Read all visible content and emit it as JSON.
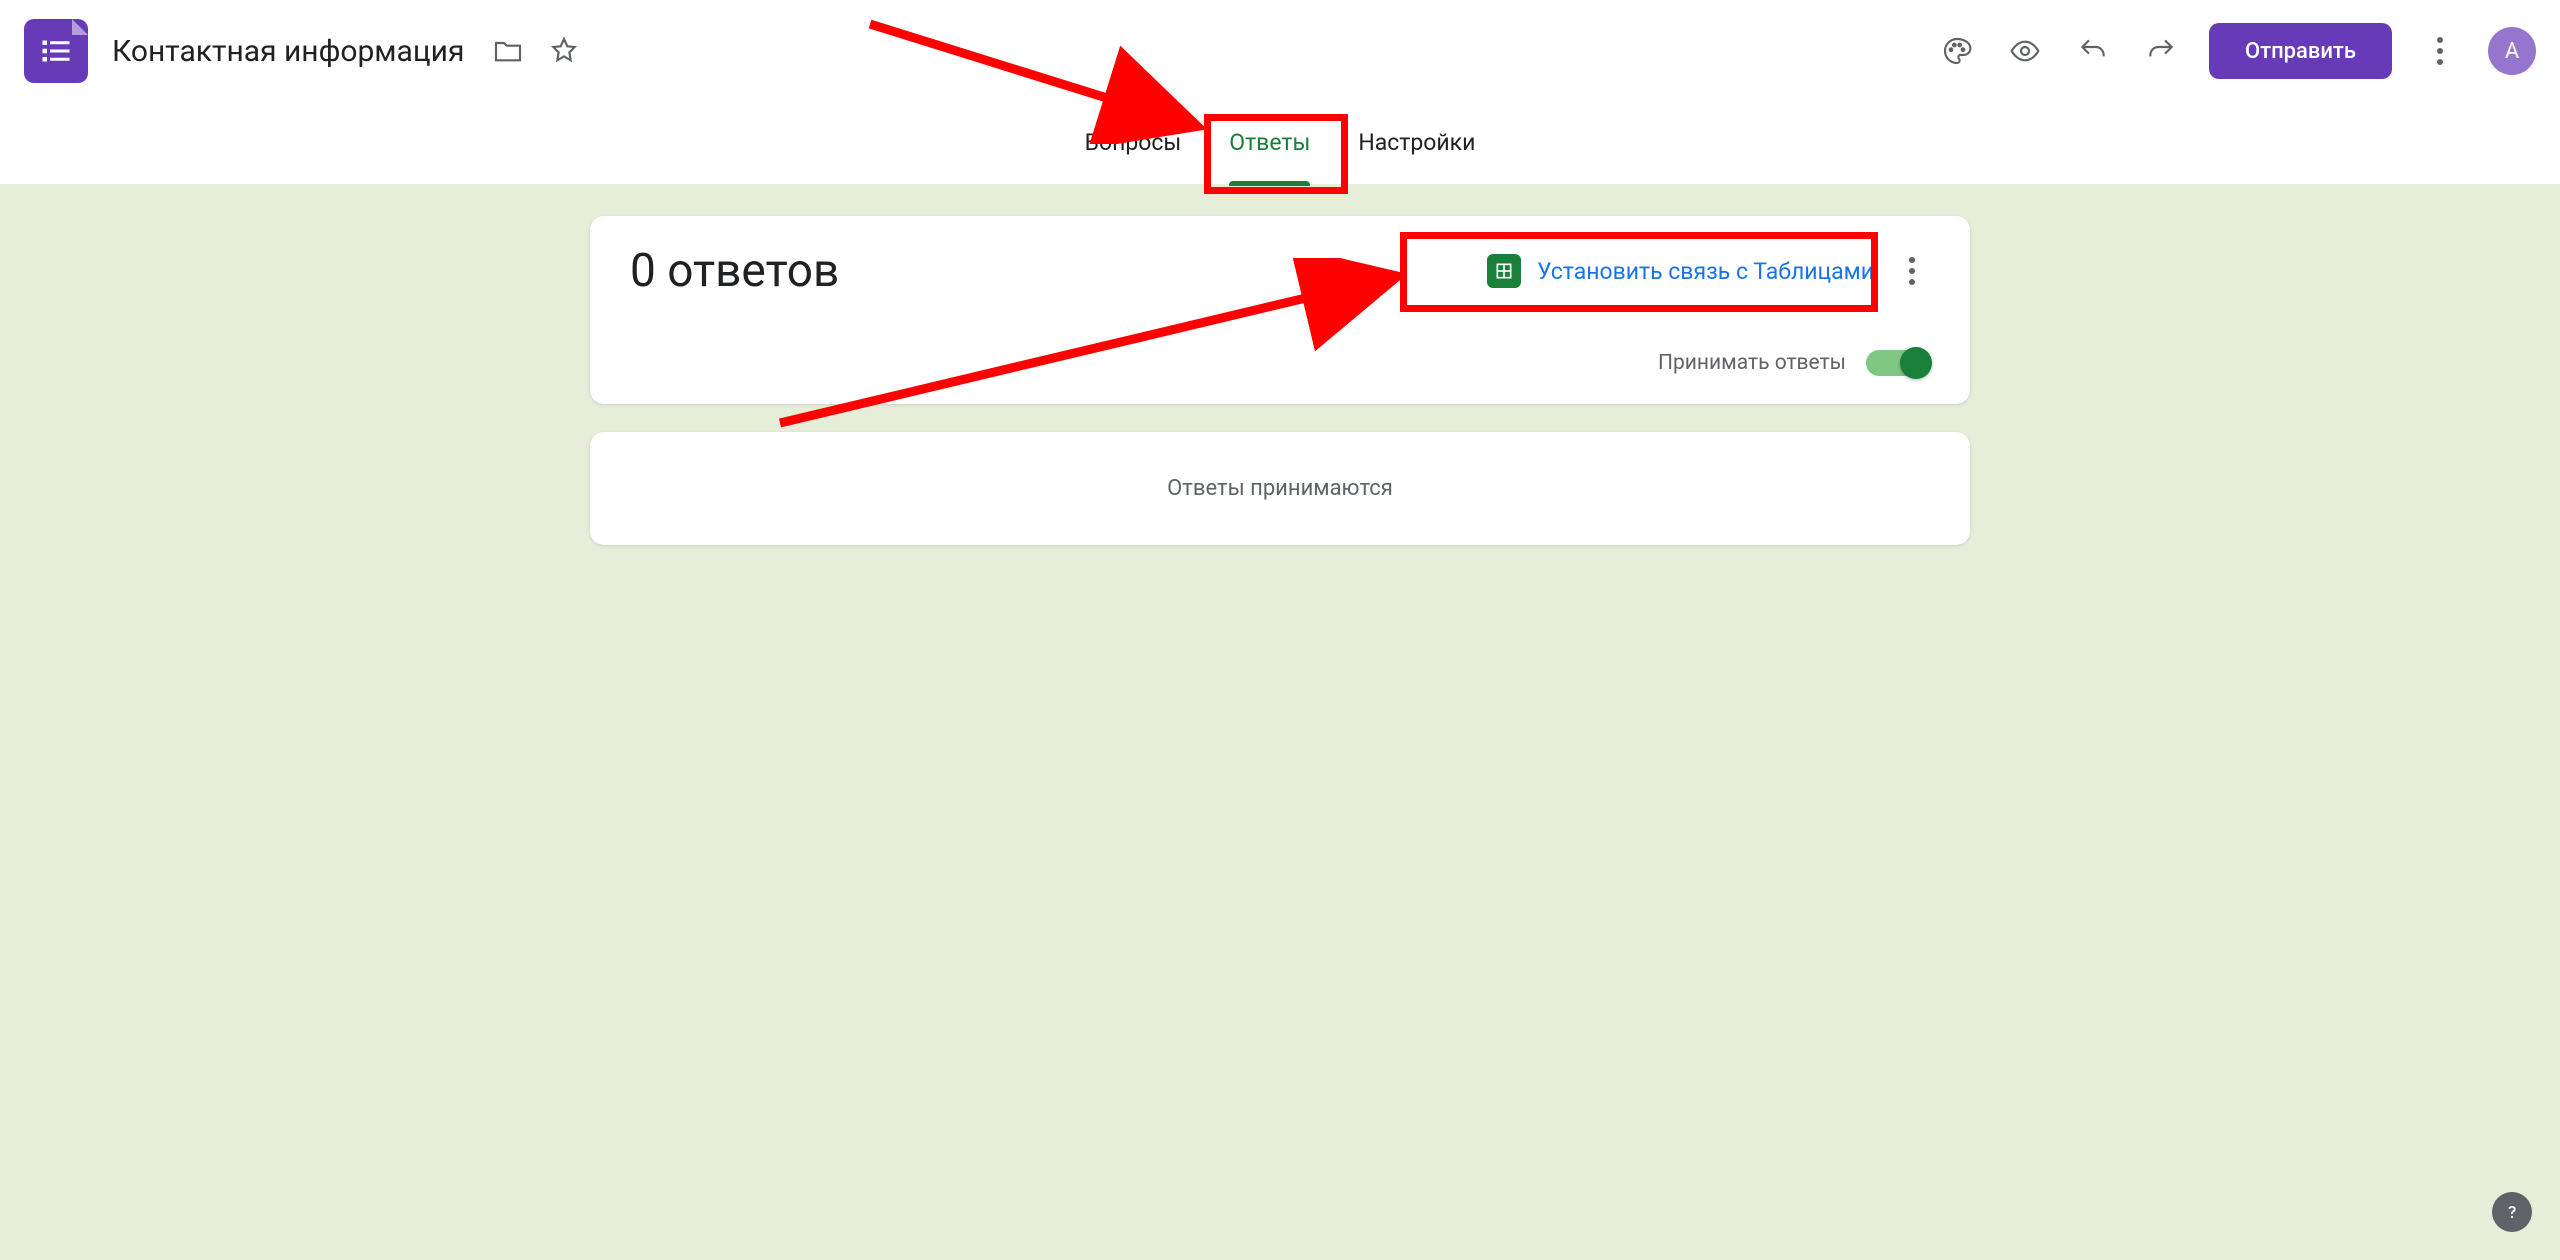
{
  "header": {
    "doc_title": "Контактная информация",
    "send_label": "Отправить",
    "avatar_initial": "A"
  },
  "tabs": {
    "questions": "Вопросы",
    "responses": "Ответы",
    "settings": "Настройки",
    "active": "responses"
  },
  "responses_card": {
    "count_text": "0 ответов",
    "sheets_link_label": "Установить связь с Таблицами",
    "accepting_label": "Принимать ответы",
    "accepting_on": true
  },
  "status_card": {
    "text": "Ответы принимаются"
  },
  "colors": {
    "purple": "#673ab7",
    "green": "#188038",
    "canvas_bg": "#e6edd9",
    "link_blue": "#1a73e8",
    "grey_fg": "#5f6368"
  }
}
